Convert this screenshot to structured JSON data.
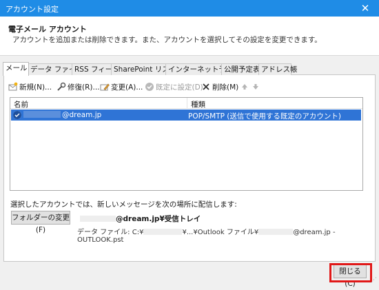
{
  "window": {
    "title": "アカウント設定",
    "close_glyph": "✕"
  },
  "header": {
    "title": "電子メール アカウント",
    "subtitle": "アカウントを追加または削除できます。また、アカウントを選択してその設定を変更できます。"
  },
  "tabs": [
    {
      "label": "メール",
      "active": true
    },
    {
      "label": "データ ファイル"
    },
    {
      "label": "RSS フィード"
    },
    {
      "label": "SharePoint リスト"
    },
    {
      "label": "インターネット予定表"
    },
    {
      "label": "公開予定表"
    },
    {
      "label": "アドレス帳"
    }
  ],
  "toolbar": {
    "new": {
      "label": "新規(N)...",
      "icon": "new-account-icon"
    },
    "repair": {
      "label": "修復(R)...",
      "icon": "repair-icon"
    },
    "change": {
      "label": "変更(A)...",
      "icon": "change-icon"
    },
    "set_default": {
      "label": "既定に設定(D)",
      "icon": "check-circle-icon",
      "disabled": true
    },
    "delete": {
      "label": "削除(M)",
      "icon": "delete-x-icon"
    },
    "move_up_icon": "arrow-up-icon",
    "move_down_icon": "arrow-down-icon"
  },
  "account_list": {
    "columns": [
      "名前",
      "種類"
    ],
    "rows": [
      {
        "name": "@dream.jp",
        "type": "POP/SMTP (送信で使用する既定のアカウント)",
        "selected": true,
        "default": true
      }
    ]
  },
  "delivery": {
    "label": "選択したアカウントでは、新しいメッセージを次の場所に配信します:",
    "change_folder_button": "フォルダーの変更(F)",
    "inbox_path": "@dream.jp¥受信トレイ",
    "data_file_prefix": "データ ファイル: C:¥",
    "data_file_mid": "¥...¥Outlook ファイル¥",
    "data_file_suffix": "@dream.jp - OUTLOOK.pst"
  },
  "footer": {
    "close_button": "閉じる(C)"
  },
  "colors": {
    "titlebar": "#1f8ce6",
    "selection": "#2f74d6",
    "highlight_box": "#e11818"
  }
}
